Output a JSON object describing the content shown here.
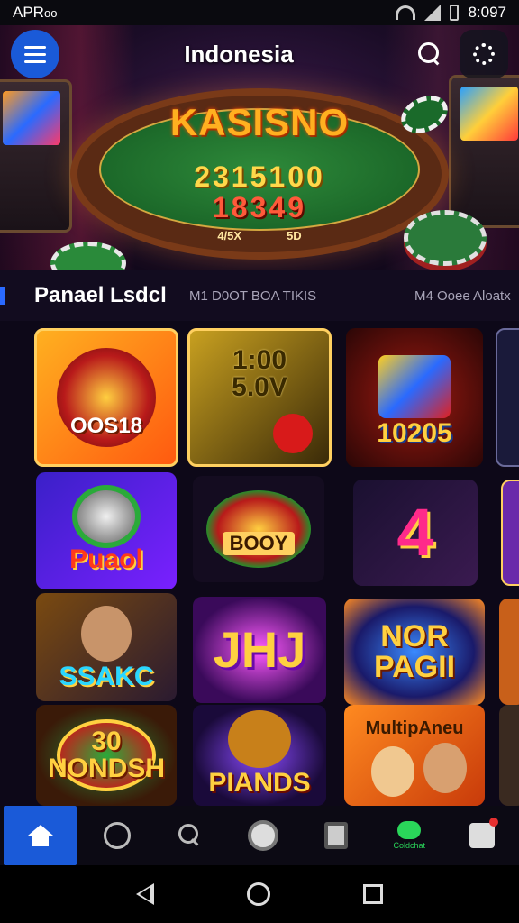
{
  "status_bar": {
    "carrier": "APR",
    "carrier_suffix": "oo",
    "time": "8:097"
  },
  "header": {
    "title": "Indonesia"
  },
  "hero": {
    "table_title": "KASISNO",
    "row1": "2315100",
    "row2": "18349",
    "bet_left": "4/5X",
    "bet_right": "5D"
  },
  "section": {
    "title": "Panael Lsdcl",
    "tab1": "M1 D0OT BOA TIKIS",
    "tab2": "M4 Ooee Aloatx"
  },
  "tiles": [
    {
      "label": "OOS18"
    },
    {
      "label": "1:00\n5.0V"
    },
    {
      "label": "10205"
    },
    {
      "label": "Puaol"
    },
    {
      "label": "BOOY"
    },
    {
      "label": "4"
    },
    {
      "label": "SSAKC"
    },
    {
      "label": "JHJ"
    },
    {
      "label": "NOR\nPAGII"
    },
    {
      "label": "30\nNONDSH"
    },
    {
      "label": "PIANDS"
    },
    {
      "label": "MultipAneu"
    }
  ],
  "bottom_nav": {
    "chat_label": "Coldchat"
  },
  "colors": {
    "accent": "#1a5ad8",
    "chat": "#2ad65a"
  }
}
